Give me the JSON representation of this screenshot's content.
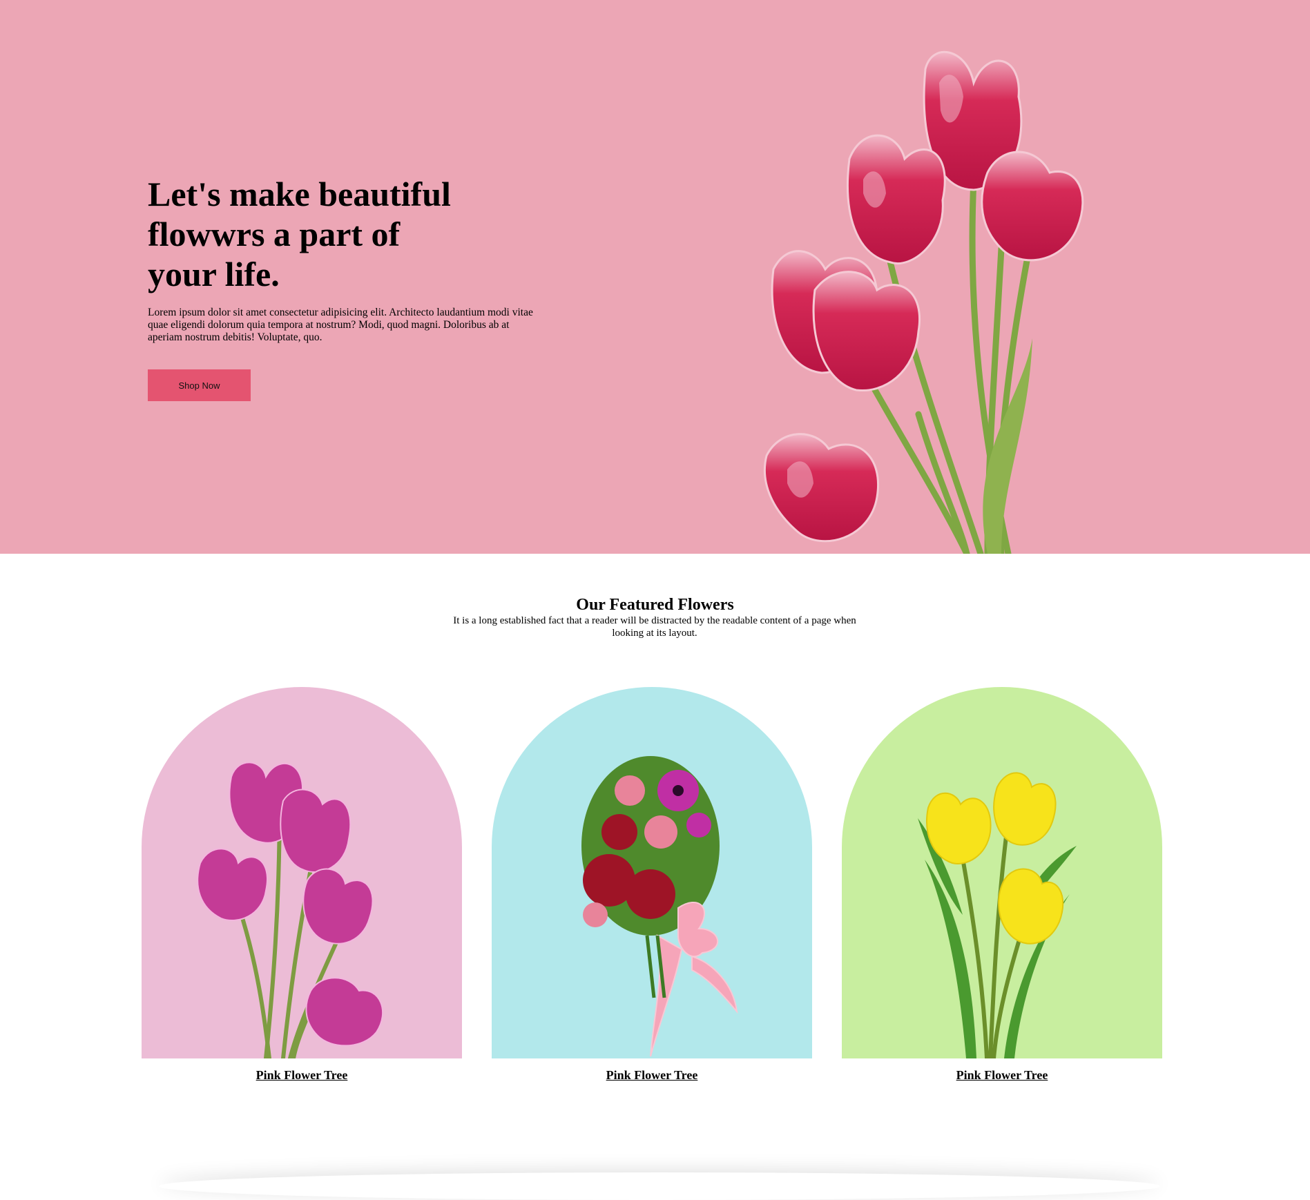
{
  "colors": {
    "hero_bg": "#eca6b5",
    "button_bg": "#e45470",
    "card_pink": "#ecbcd6",
    "card_blue": "#b2e8eb",
    "card_green": "#c8ee9f"
  },
  "hero": {
    "title": "Let's make beautiful flowwrs a part of your life.",
    "description": "Lorem ipsum dolor sit amet consectetur adipisicing elit. Architecto laudantium modi vitae quae eligendi dolorum quia tempora at nostrum? Modi, quod magni. Doloribus ab at aperiam nostrum debitis! Voluptate, quo.",
    "cta_label": "Shop Now",
    "image": "pink-tulips-bouquet"
  },
  "featured": {
    "title": "Our Featured Flowers",
    "subtitle": "It is a long established fact that a reader will be distracted by the readable content of a page when looking at its layout.",
    "cards": [
      {
        "label": "Pink Flower Tree",
        "image": "magenta-tulips",
        "bg": "#ecbcd6"
      },
      {
        "label": "Pink Flower Tree",
        "image": "mixed-bouquet-with-ribbon",
        "bg": "#b2e8eb"
      },
      {
        "label": "Pink Flower Tree",
        "image": "yellow-tulips",
        "bg": "#c8ee9f"
      }
    ]
  }
}
